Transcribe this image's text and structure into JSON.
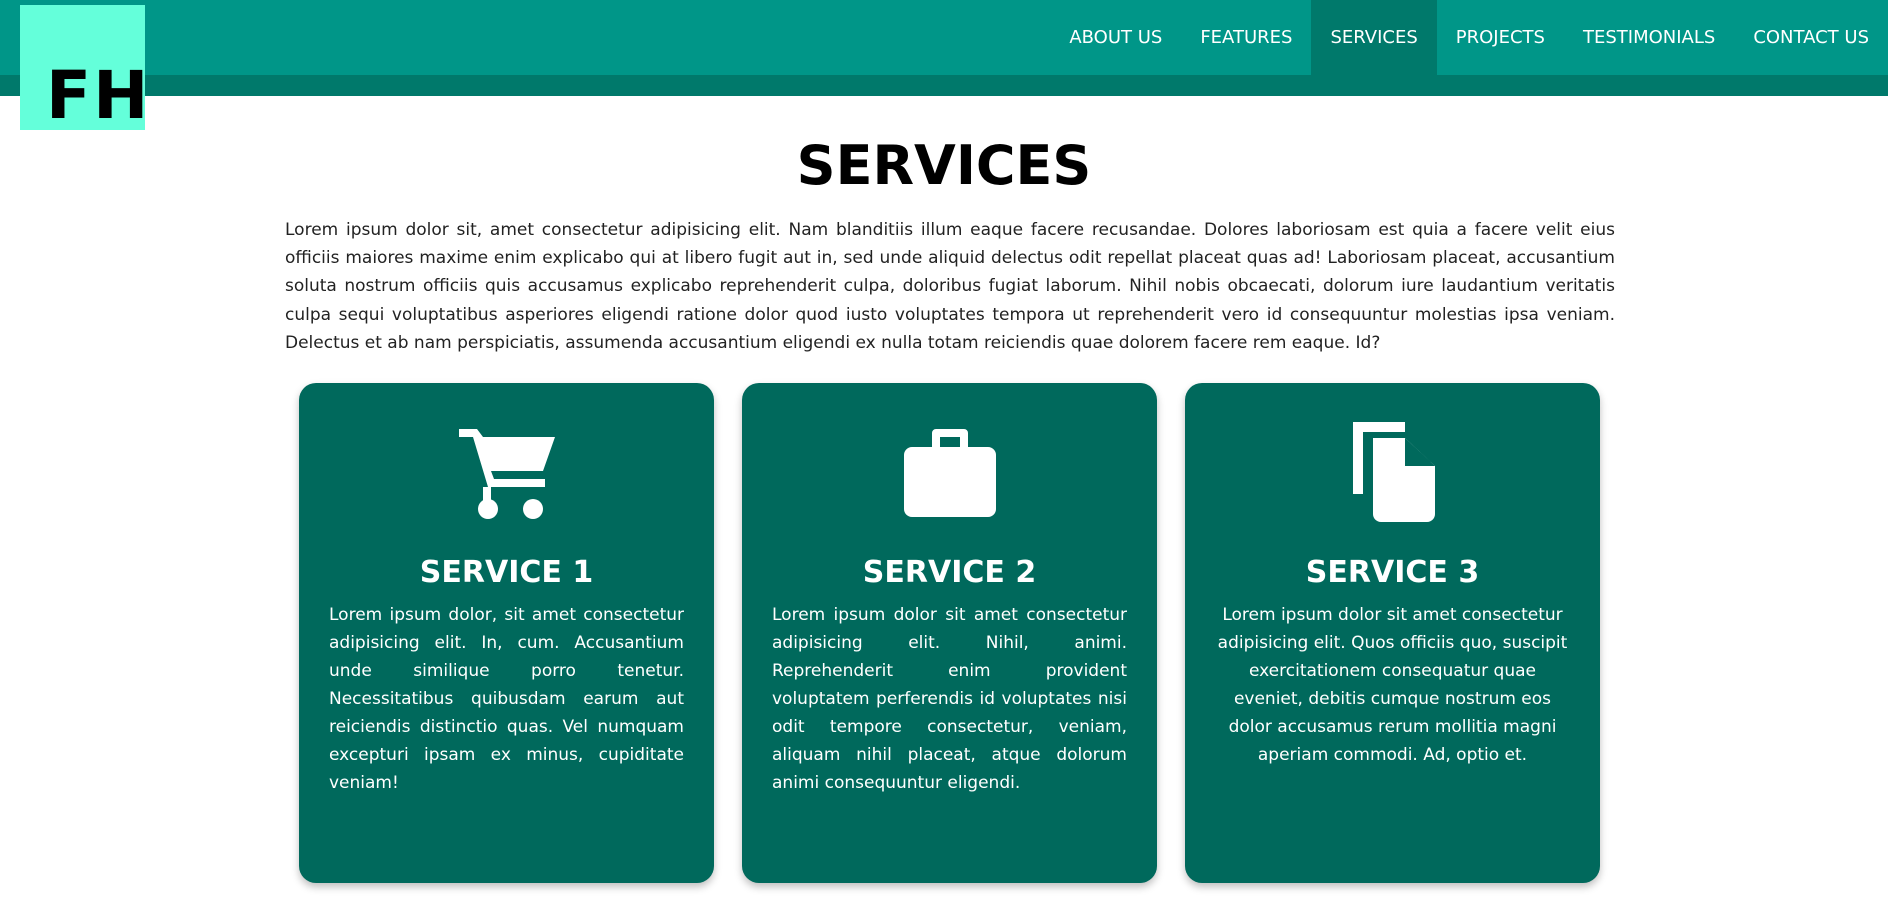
{
  "logo": {
    "text": "FH"
  },
  "nav": {
    "items": [
      {
        "label": "ABOUT US"
      },
      {
        "label": "FEATURES"
      },
      {
        "label": "SERVICES"
      },
      {
        "label": "PROJECTS"
      },
      {
        "label": "TESTIMONIALS"
      },
      {
        "label": "CONTACT US"
      }
    ],
    "active_index": 2
  },
  "section": {
    "title": "SERVICES",
    "intro": "Lorem ipsum dolor sit, amet consectetur adipisicing elit. Nam blanditiis illum eaque facere recusandae. Dolores laboriosam est quia a facere velit eius officiis maiores maxime enim explicabo qui at libero fugit aut in, sed unde aliquid delectus odit repellat placeat quas ad! Laboriosam placeat, accusantium soluta nostrum officiis quis accusamus explicabo reprehenderit culpa, doloribus fugiat laborum. Nihil nobis obcaecati, dolorum iure laudantium veritatis culpa sequi voluptatibus asperiores eligendi ratione dolor quod iusto voluptates tempora ut reprehenderit vero id consequuntur molestias ipsa veniam. Delectus et ab nam perspiciatis, assumenda accusantium eligendi ex nulla totam reiciendis quae dolorem facere rem eaque. Id?"
  },
  "cards": [
    {
      "icon": "shopping-cart-icon",
      "title": "SERVICE 1",
      "text": "Lorem ipsum dolor, sit amet consectetur adipisicing elit. In, cum. Accusantium unde similique porro tenetur. Necessitatibus quibusdam earum aut reiciendis distinctio quas. Vel numquam excepturi ipsam ex minus, cupiditate veniam!"
    },
    {
      "icon": "briefcase-icon",
      "title": "SERVICE 2",
      "text": "Lorem ipsum dolor sit amet consectetur adipisicing elit. Nihil, animi. Reprehenderit enim provident voluptatem perferendis id voluptates nisi odit tempore consectetur, veniam, aliquam nihil placeat, atque dolorum animi consequuntur eligendi."
    },
    {
      "icon": "copy-document-icon",
      "title": "SERVICE 3",
      "text": "Lorem ipsum dolor sit amet consectetur adipisicing elit. Quos officiis quo, suscipit exercitationem consequatur quae eveniet, debitis cumque nostrum eos dolor accusamus rerum mollitia magni aperiam commodi. Ad, optio et."
    }
  ],
  "colors": {
    "header": "#009688",
    "header_accent": "#00796b",
    "logo_bg": "#64ffda",
    "card_bg": "#00695c"
  }
}
